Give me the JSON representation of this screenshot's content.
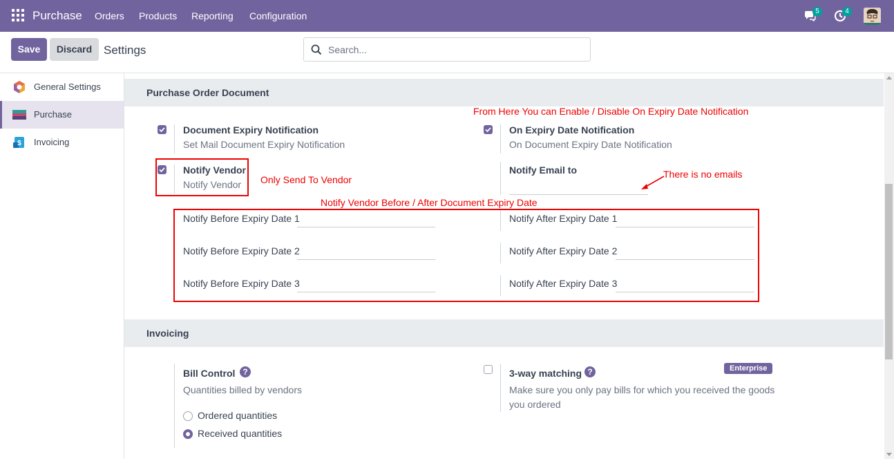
{
  "navbar": {
    "app_name": "Purchase",
    "menu": [
      "Orders",
      "Products",
      "Reporting",
      "Configuration"
    ],
    "messages_count": "5",
    "activities_count": "4",
    "icons": [
      "apps-grid-icon",
      "chat-icon",
      "clock-icon",
      "user-avatar"
    ]
  },
  "control_panel": {
    "save_label": "Save",
    "discard_label": "Discard",
    "title": "Settings",
    "search_placeholder": "Search..."
  },
  "sidebar": {
    "items": [
      {
        "label": "General Settings",
        "icon": "odoo-logo-icon",
        "active": false
      },
      {
        "label": "Purchase",
        "icon": "purchase-app-icon",
        "active": true
      },
      {
        "label": "Invoicing",
        "icon": "invoicing-app-icon",
        "active": false
      }
    ]
  },
  "pod_section": {
    "title": "Purchase Order Document",
    "doc_expiry": {
      "title": "Document Expiry Notification",
      "desc": "Set Mail Document Expiry Notification",
      "checked": true
    },
    "on_expiry": {
      "title": "On Expiry Date Notification",
      "desc": "On Document Expiry Date Notification",
      "checked": true
    },
    "notify_vendor": {
      "title": "Notify Vendor",
      "desc": "Notify Vendor",
      "checked": true
    },
    "notify_email": {
      "title": "Notify Email to",
      "value": ""
    },
    "before_fields": [
      "Notify Before Expiry Date 1",
      "Notify Before Expiry Date 2",
      "Notify Before Expiry Date 3"
    ],
    "after_fields": [
      "Notify After Expiry Date 1",
      "Notify After Expiry Date 2",
      "Notify After Expiry Date 3"
    ]
  },
  "annotations": {
    "on_expiry_note": "From Here You can Enable / Disable On Expiry Date Notification",
    "vendor_note": "Only Send To Vendor",
    "emails_note": "There is no emails",
    "before_after_note": "Notify Vendor Before / After Document Expiry Date",
    "color": "#ee0000"
  },
  "invoicing_section": {
    "title": "Invoicing",
    "bill_control": {
      "title": "Bill Control",
      "desc": "Quantities billed by vendors",
      "options": [
        "Ordered quantities",
        "Received quantities"
      ],
      "selected": "Received quantities"
    },
    "three_way": {
      "title": "3-way matching",
      "desc_line1": "Make sure you only pay bills for which you received the goods",
      "desc_line2": "you ordered",
      "badge": "Enterprise",
      "checked": false
    }
  },
  "colors": {
    "brand": "#71639e",
    "badge": "#00a09d"
  }
}
